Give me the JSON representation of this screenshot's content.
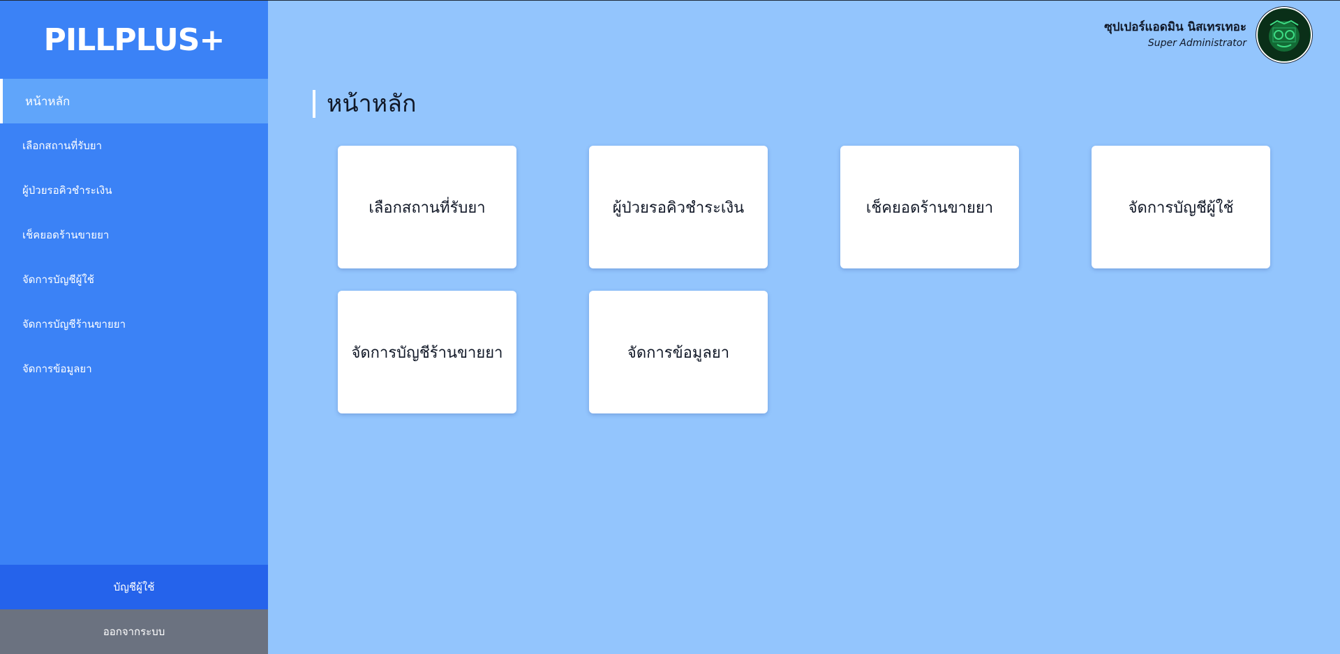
{
  "app": {
    "logo": "PILLPLUS+"
  },
  "sidebar": {
    "items": [
      {
        "label": "หน้าหลัก",
        "active": true
      },
      {
        "label": "เลือกสถานที่รับยา"
      },
      {
        "label": "ผู้ป่วยรอคิวชำระเงิน"
      },
      {
        "label": "เช็คยอดร้านขายยา"
      },
      {
        "label": "จัดการบัญชีผู้ใช้"
      },
      {
        "label": "จัดการบัญชีร้านขายยา"
      },
      {
        "label": "จัดการข้อมูลยา"
      }
    ],
    "account_label": "บัญชีผู้ใช้",
    "logout_label": "ออกจากระบบ"
  },
  "header": {
    "user_name": "ซุปเปอร์แอดมิน นิสเทรเทอะ",
    "user_role": "Super Administrator"
  },
  "main": {
    "title": "หน้าหลัก",
    "tiles": [
      "เลือกสถานที่รับยา",
      "ผู้ป่วยรอคิวชำระเงิน",
      "เช็คยอดร้านขายยา",
      "จัดการบัญชีผู้ใช้",
      "จัดการบัญชีร้านขายยา",
      "จัดการข้อมูลยา"
    ]
  },
  "colors": {
    "sidebar": "#3b82f6",
    "sidebar_active": "#60a5fa",
    "account_button": "#2563eb",
    "logout_button": "#6b7280",
    "background": "#93c5fd"
  }
}
